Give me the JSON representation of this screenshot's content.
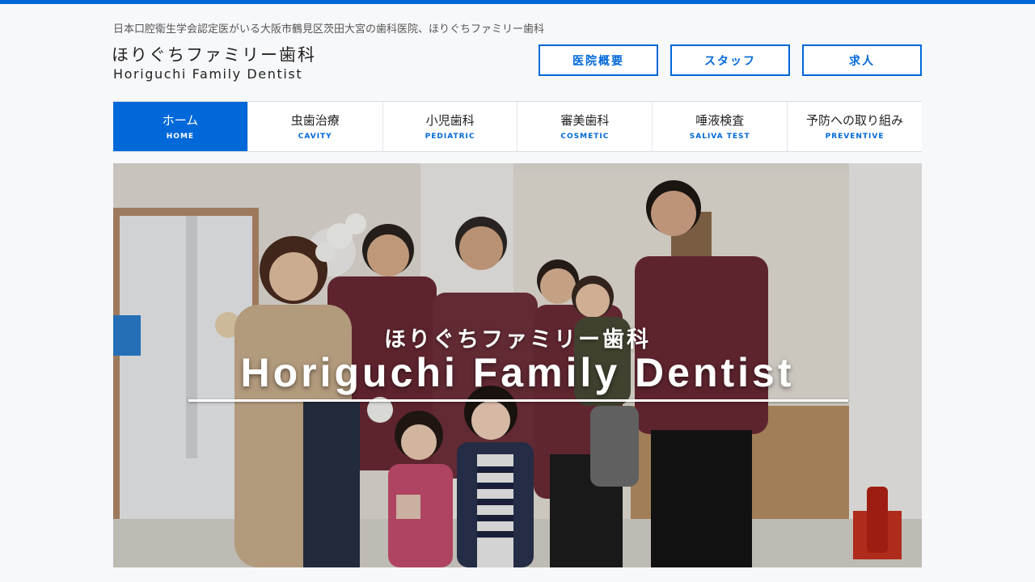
{
  "header": {
    "tagline": "日本口腔衛生学会認定医がいる大阪市鶴見区茨田大宮の歯科医院、ほりぐちファミリー歯科",
    "logo_jp": "ほりぐちファミリー歯科",
    "logo_en": "Horiguchi Family Dentist",
    "buttons": [
      {
        "label": "医院概要"
      },
      {
        "label": "スタッフ"
      },
      {
        "label": "求人"
      }
    ]
  },
  "nav": {
    "items": [
      {
        "label": "ホーム",
        "sub": "HOME",
        "active": true
      },
      {
        "label": "虫歯治療",
        "sub": "CAVITY"
      },
      {
        "label": "小児歯科",
        "sub": "PEDIATRIC"
      },
      {
        "label": "審美歯科",
        "sub": "COSMETIC"
      },
      {
        "label": "唾液検査",
        "sub": "SALIVA TEST"
      },
      {
        "label": "予防への取り組み",
        "sub": "PREVENTIVE"
      }
    ]
  },
  "hero": {
    "title_jp": "ほりぐちファミリー歯科",
    "title_en": "Horiguchi Family Dentist",
    "image": "staff-group-photo"
  },
  "colors": {
    "accent": "#0068d9",
    "background": "#f7f8fa",
    "scrubs": "#6b2a35"
  }
}
